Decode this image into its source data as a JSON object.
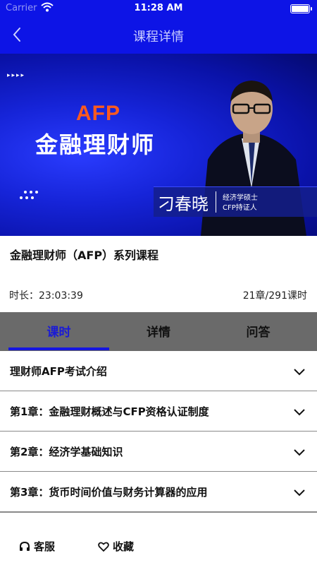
{
  "status_bar": {
    "carrier": "Carrier",
    "time": "11:28 AM"
  },
  "nav": {
    "title": "课程详情",
    "back_icon": "chevron-left-icon"
  },
  "banner": {
    "afp": "AFP",
    "title": "金融理财师",
    "teacher_name": "刁春晓",
    "teacher_title_1": "经济学硕士",
    "teacher_title_2": "CFP持证人"
  },
  "course": {
    "title": "金融理财师（AFP）系列课程",
    "duration": "时长：23:03:39",
    "counts": "21章/291课时"
  },
  "tabs": [
    {
      "label": "课时",
      "active": true
    },
    {
      "label": "详情",
      "active": false
    },
    {
      "label": "问答",
      "active": false
    }
  ],
  "chapters": [
    {
      "label": "理财师AFP考试介绍"
    },
    {
      "label": "第1章：金融理财概述与CFP资格认证制度"
    },
    {
      "label": "第2章：经济学基础知识"
    },
    {
      "label": "第3章：货币时间价值与财务计算器的应用"
    }
  ],
  "bottom_bar": {
    "service_label": "客服",
    "favorite_label": "收藏"
  },
  "colors": {
    "brand_blue": "#0d14e6",
    "accent_orange": "#ff5a1e",
    "tab_bg": "#6a6a6a"
  }
}
